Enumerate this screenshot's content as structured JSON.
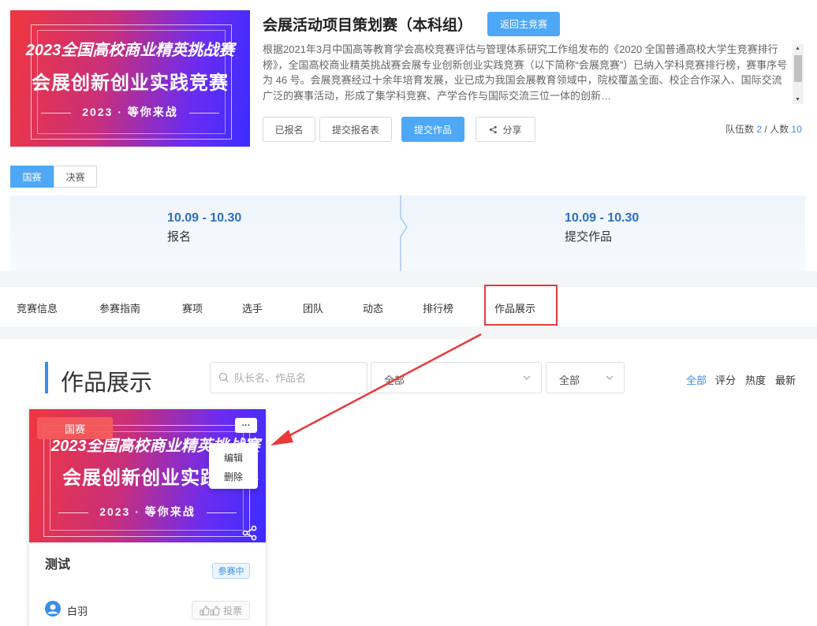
{
  "banner": {
    "line1": "2023全国高校商业精英挑战赛",
    "line2": "会展创新创业实践竞赛",
    "line3": "2023 · 等你来战"
  },
  "header": {
    "title": "会展活动项目策划赛（本科组）",
    "back_button": "返回主竞赛",
    "description": "根据2021年3月中国高等教育学会高校竞赛评估与管理体系研究工作组发布的《2020 全国普通高校大学生竞赛排行榜》，全国高校商业精英挑战赛会展专业创新创业实践竞赛（以下简称“会展竞赛”）已纳入学科竞赛排行榜，赛事序号为 46 号。会展竞赛经过十余年培育发展，业已成为我国会展教育领域中，院校覆盖全面、校企合作深入、国际交流广泛的赛事活动，形成了集学科竞赛、产学合作与国际交流三位一体的创新…"
  },
  "actions": {
    "registered": "已报名",
    "submit_form": "提交报名表",
    "submit_work": "提交作品",
    "share": "分享"
  },
  "team_stats": {
    "teams_label": "队伍数",
    "teams": "2",
    "sep": " / ",
    "people_label": "人数",
    "people": "10"
  },
  "stage_tabs": [
    "国赛",
    "决赛"
  ],
  "timeline": [
    {
      "date": "10.09 - 10.30",
      "label": "报名"
    },
    {
      "date": "10.09 - 10.30",
      "label": "提交作品"
    }
  ],
  "nav": [
    "竞赛信息",
    "参赛指南",
    "赛项",
    "选手",
    "团队",
    "动态",
    "排行榜",
    "作品展示"
  ],
  "gallery": {
    "title": "作品展示",
    "search_placeholder": "队长名、作品名",
    "select1": "全部",
    "select2": "全部",
    "sort": [
      "全部",
      "评分",
      "热度",
      "最新"
    ]
  },
  "card": {
    "tag": "国赛",
    "more": "···",
    "menu": [
      "编辑",
      "删除"
    ],
    "title": "测试",
    "status": "参赛中",
    "author": "白羽",
    "vote": "投票"
  },
  "colors": {
    "accent": "#4ea8f5",
    "link": "#3a8ee6",
    "highlight": "#e8393a"
  }
}
